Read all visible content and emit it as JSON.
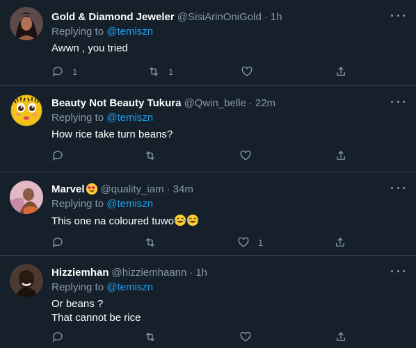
{
  "tweets": [
    {
      "name": "Gold & Diamond Jeweler",
      "handle": "@SisiArinOniGold",
      "time": "1h",
      "replying_prefix": "Replying to ",
      "replying_to": "@temiszn",
      "lines": [
        "Awwn , you tried"
      ],
      "reply_count": "1",
      "retweet_count": "1",
      "like_count": ""
    },
    {
      "name": "Beauty Not Beauty Tukura",
      "handle": "@Qwin_belle",
      "time": "22m",
      "replying_prefix": "Replying to ",
      "replying_to": "@temiszn",
      "lines": [
        "How rice take turn beans?"
      ],
      "reply_count": "",
      "retweet_count": "",
      "like_count": ""
    },
    {
      "name": "Marvel",
      "handle": "@quality_iam",
      "time": "34m",
      "replying_prefix": "Replying to ",
      "replying_to": "@temiszn",
      "lines": [
        "This one na coloured tuwo"
      ],
      "reply_count": "",
      "retweet_count": "",
      "like_count": "1"
    },
    {
      "name": "Hizziemhan",
      "handle": "@hizziemhaann",
      "time": "1h",
      "replying_prefix": "Replying to ",
      "replying_to": "@temiszn",
      "lines": [
        "Or beans ?",
        "That cannot be rice"
      ],
      "reply_count": "",
      "retweet_count": "",
      "like_count": ""
    }
  ],
  "separator": "·",
  "icons": {
    "reply": "reply-icon",
    "retweet": "retweet-icon",
    "like": "heart-icon",
    "share": "share-icon",
    "more": "more-icon",
    "heart_eyes": "heart-eyes-emoji",
    "laughing": "tears-of-joy-emoji"
  },
  "colors": {
    "background": "#15202b",
    "divider": "#38444d",
    "secondary_text": "#8899a6",
    "mention": "#1da1f2"
  }
}
